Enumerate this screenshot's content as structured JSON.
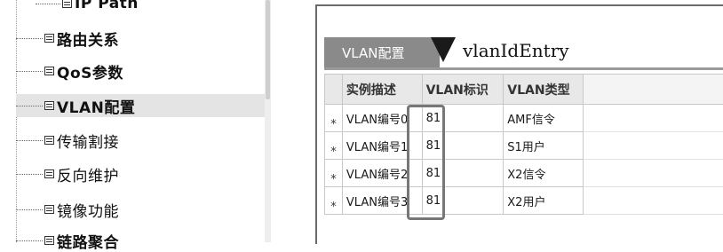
{
  "tree": {
    "items": [
      {
        "label": "IP Path",
        "icon": "document-icon",
        "selected": false
      },
      {
        "label": "路由关系",
        "icon": "document-icon",
        "selected": false
      },
      {
        "label": "QoS参数",
        "icon": "document-icon",
        "selected": false
      },
      {
        "label": "VLAN配置",
        "icon": "document-icon",
        "selected": true
      },
      {
        "label": "传输割接",
        "icon": "document-icon",
        "selected": false
      },
      {
        "label": "反向维护",
        "icon": "document-icon",
        "selected": false
      },
      {
        "label": "镜像功能",
        "icon": "document-icon",
        "selected": false
      },
      {
        "label": "链路聚合",
        "icon": "document-icon",
        "selected": false
      }
    ]
  },
  "panel": {
    "tab_label": "VLAN配置",
    "title": "vlanIdEntry"
  },
  "grid": {
    "headers": [
      "实例描述",
      "VLAN标识",
      "VLAN类型"
    ],
    "row_marker": "*",
    "rows": [
      [
        "VLAN编号0",
        "81",
        "AMF信令"
      ],
      [
        "VLAN编号1",
        "81",
        "S1用户"
      ],
      [
        "VLAN编号2",
        "81",
        "X2信令"
      ],
      [
        "VLAN编号3",
        "81",
        "X2用户"
      ]
    ]
  },
  "colors": {
    "tab_background": "#8a8a8a",
    "selected_item_background": "#e4e4e4",
    "header_background": "#e8e8e8"
  }
}
